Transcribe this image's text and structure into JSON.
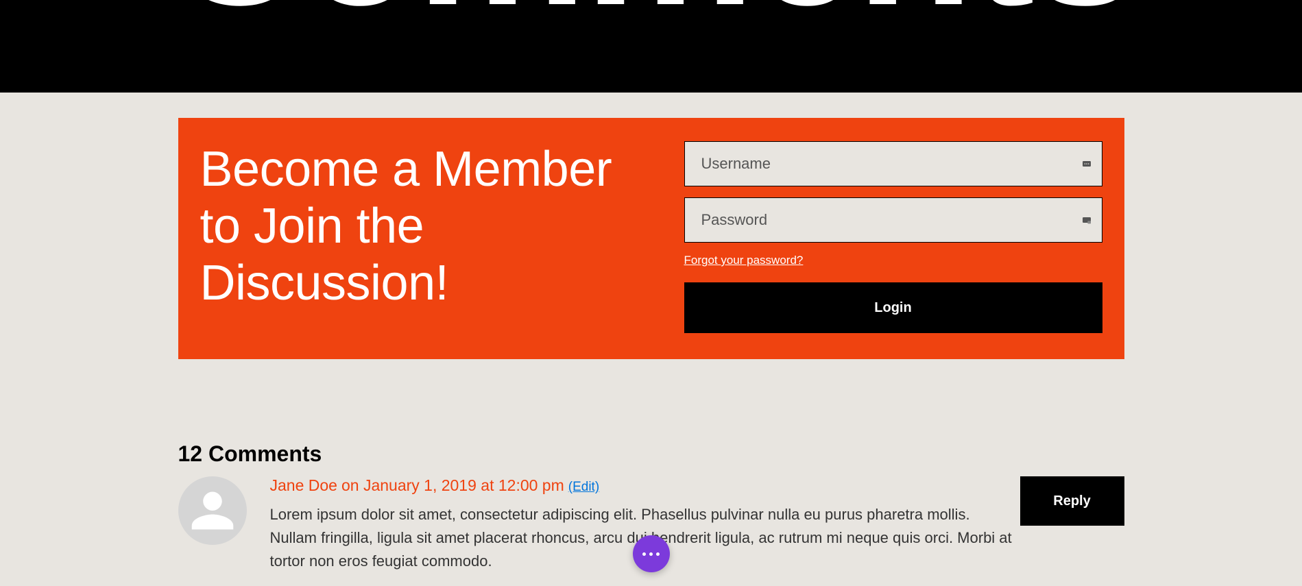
{
  "hero": {
    "title": "Comments"
  },
  "member": {
    "heading": "Become a Member to Join the Discussion!",
    "username_placeholder": "Username",
    "password_placeholder": "Password",
    "forgot_label": "Forgot your password?",
    "login_label": "Login"
  },
  "comments": {
    "heading": "12 Comments",
    "list": [
      {
        "author": "Jane Doe",
        "dateline": "on January 1, 2019 at 12:00 pm",
        "edit_label": "(Edit)",
        "body": "Lorem ipsum dolor sit amet, consectetur adipiscing elit. Phasellus pulvinar nulla eu purus pharetra mollis. Nullam fringilla, ligula sit amet placerat rhoncus, arcu dui hendrerit ligula, ac rutrum mi neque quis orci. Morbi at tortor non eros feugiat commodo.",
        "reply_label": "Reply"
      }
    ]
  }
}
